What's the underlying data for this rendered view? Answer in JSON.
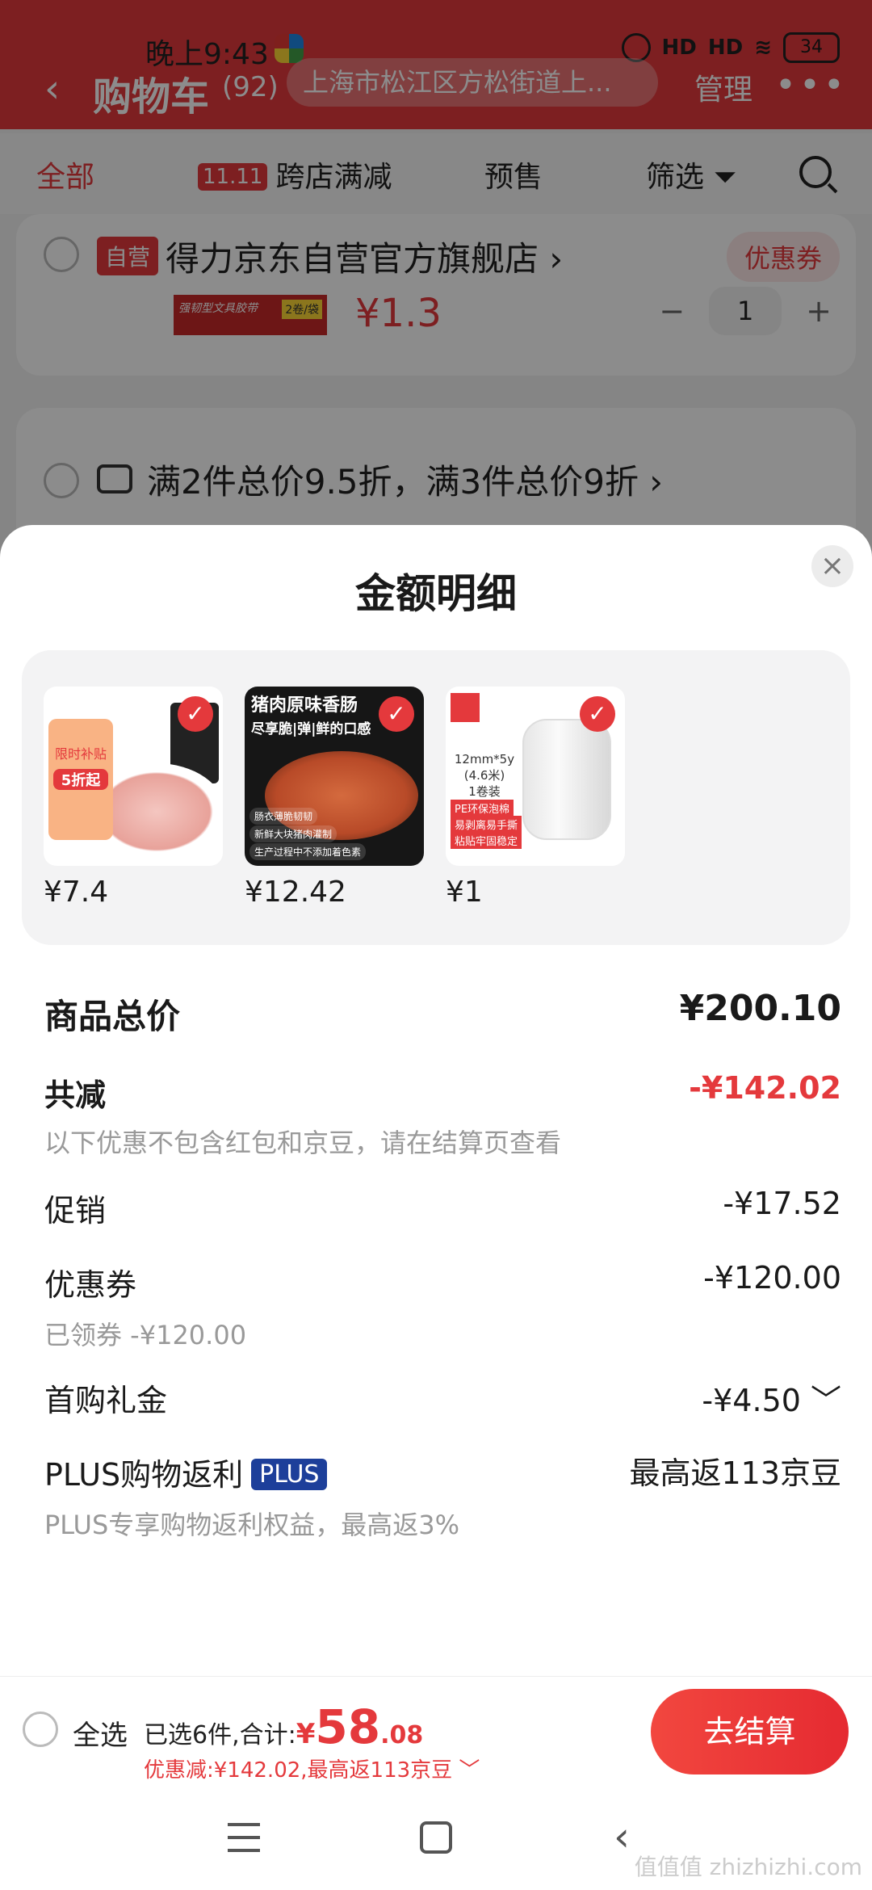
{
  "status_bar": {
    "time": "晚上9:43",
    "signal1": "HD",
    "signal2": "HD",
    "battery": "34"
  },
  "header": {
    "title": "购物车",
    "count": "(92)",
    "address": "上海市松江区方松街道上...",
    "manage": "管理"
  },
  "filter_tabs": {
    "all": "全部",
    "cross_store_badge": "11.11",
    "cross_store": "跨店满减",
    "presale": "预售",
    "filter": "筛选"
  },
  "store_card": {
    "self_tag": "自营",
    "store_name": "得力京东自营官方旗舰店 ›",
    "coupon": "优惠券",
    "price": "¥1.3",
    "quantity": "1",
    "minus": "−",
    "plus": "+",
    "img_text": "强韧型文具胶带",
    "img_badge": "2卷/袋"
  },
  "promo_card": {
    "text": "满2件总价9.5折，满3件总价9折 ›"
  },
  "sheet": {
    "title": "金额明细",
    "products": [
      {
        "price": "¥7.4",
        "sticker": "限时补贴",
        "sticker_badge": "5折起"
      },
      {
        "price": "¥12.42",
        "headline": "猪肉原味香肠",
        "subline": "尽享脆|弹|鲜的口感",
        "tags": [
          "肠衣薄脆韧韧",
          "新鲜大块猪肉灌制",
          "生产过程中不添加着色素"
        ]
      },
      {
        "price": "¥1",
        "spec": "12mm*5y\n(4.6米)\n1卷装",
        "tags": [
          "PE环保泡棉",
          "易剥离易手撕",
          "粘贴牢固稳定"
        ]
      }
    ],
    "total_label": "商品总价",
    "total_value": "¥200.10",
    "reduce_label": "共减",
    "reduce_value": "-¥142.02",
    "reduce_note": "以下优惠不包含红包和京豆，请在结算页查看",
    "promo_label": "促销",
    "promo_value": "-¥17.52",
    "coupon_label": "优惠券",
    "coupon_value": "-¥120.00",
    "coupon_note": "已领券 -¥120.00",
    "first_gift_label": "首购礼金",
    "first_gift_value": "-¥4.50 ﹀",
    "plus_label": "PLUS购物返利",
    "plus_badge": "PLUS",
    "plus_value": "最高返113京豆",
    "plus_note": "PLUS专享购物返利权益，最高返3%"
  },
  "bottom_bar": {
    "select_all": "全选",
    "selected_prefix": "已选6件,合计:",
    "currency": "¥",
    "total_int": "58",
    "total_dec": ".08",
    "saved": "优惠减:¥142.02,最高返113京豆 ﹀",
    "checkout": "去结算"
  },
  "watermark": "值值值 zhizhizhi.com",
  "colors": {
    "accent": "#e4393c",
    "plus_blue": "#1d3f9a"
  }
}
